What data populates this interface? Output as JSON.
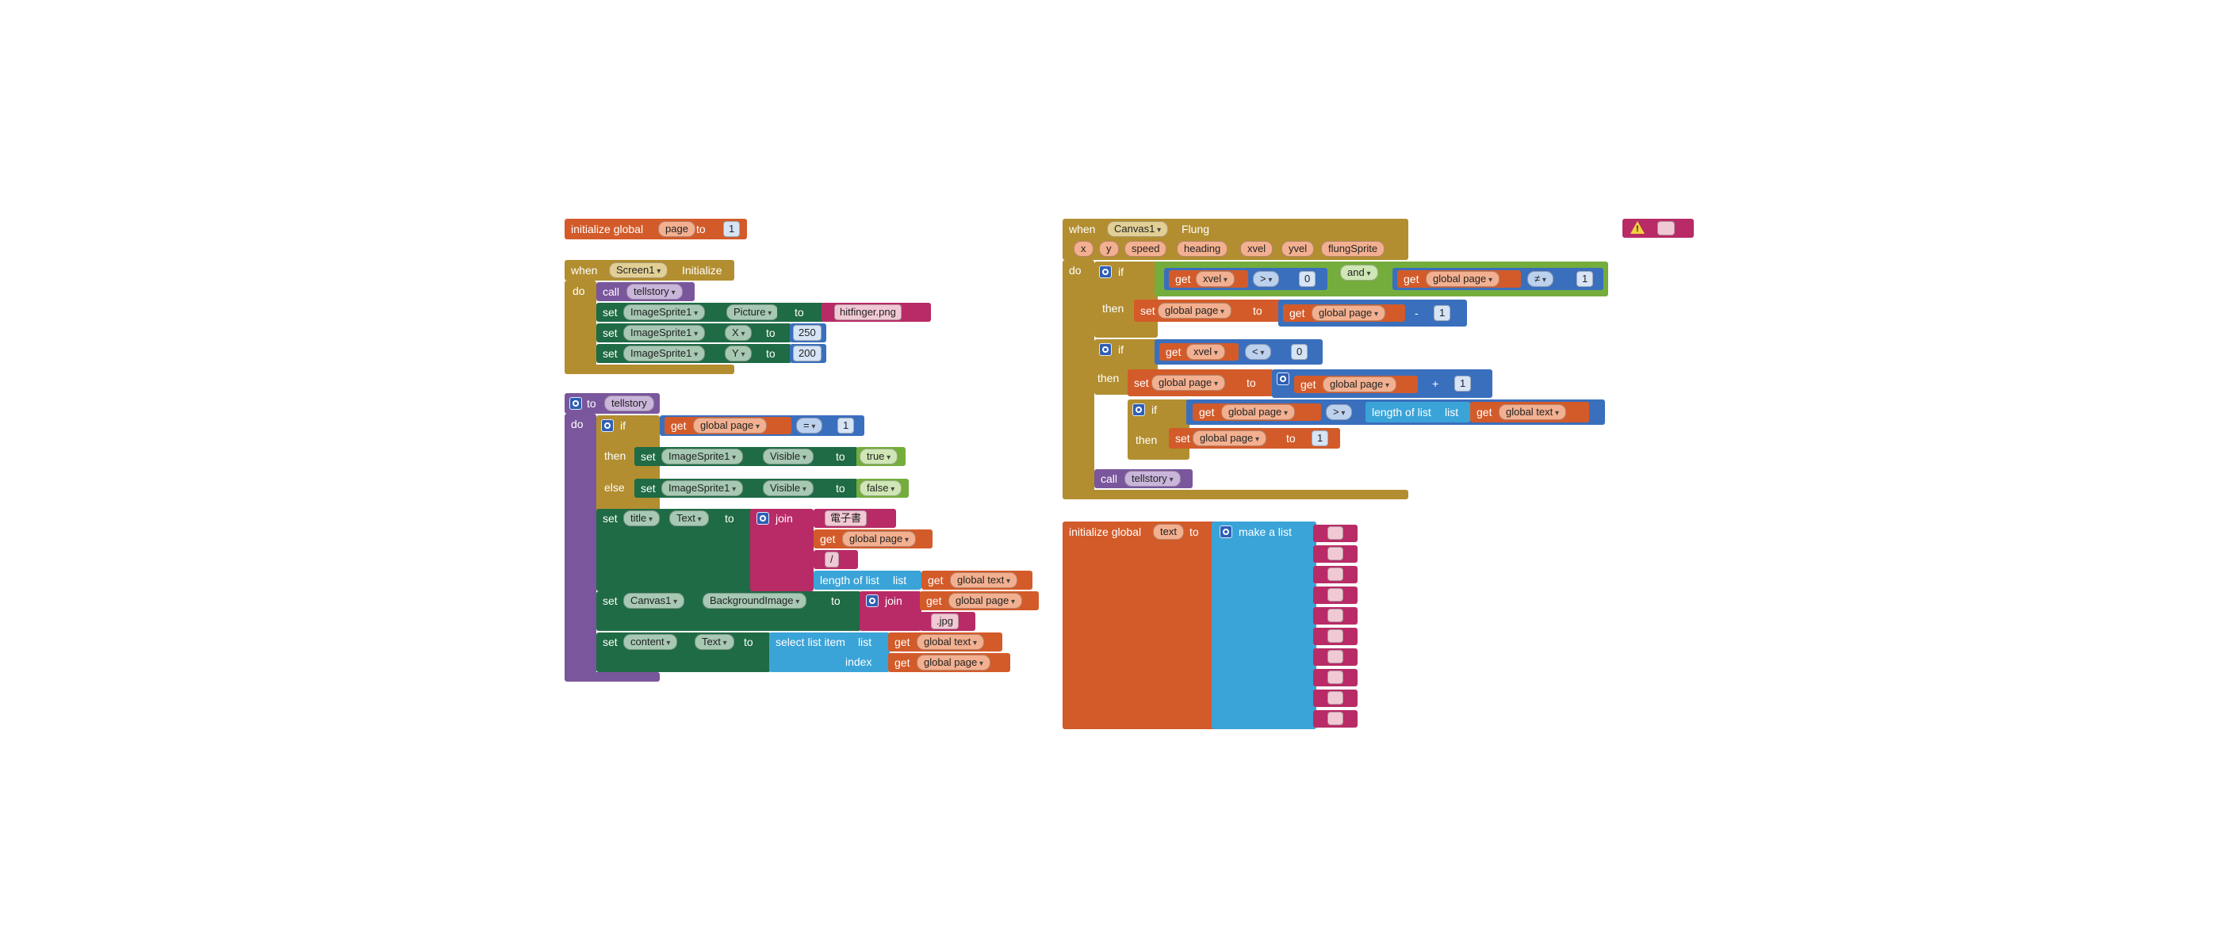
{
  "colors": {
    "variable": "#d35b2a",
    "control": "#b28e30",
    "procedure": "#7a569c",
    "component": "#1f6b45",
    "logic": "#3a6fbd",
    "list": "#3aa4d8",
    "text": "#b82b66",
    "boolean": "#74ad3c"
  },
  "init_page": {
    "label": "initialize global",
    "name": "page",
    "to": "to",
    "value": "1"
  },
  "screen_init": {
    "when": "when",
    "component": "Screen1",
    "event": "Initialize",
    "do": "do",
    "call": "call",
    "proc": "tellstory",
    "set1": {
      "set": "set",
      "comp": "ImageSprite1",
      "prop": "Picture",
      "to": "to",
      "value": "hitfinger.png"
    },
    "set2": {
      "set": "set",
      "comp": "ImageSprite1",
      "prop": "X",
      "to": "to",
      "value": "250"
    },
    "set3": {
      "set": "set",
      "comp": "ImageSprite1",
      "prop": "Y",
      "to": "to",
      "value": "200"
    }
  },
  "tellstory": {
    "to": "to",
    "name": "tellstory",
    "do": "do",
    "if": "if",
    "get": "get",
    "var": "global page",
    "op": "=",
    "cmp": "1",
    "then": "then",
    "else": "else",
    "set_visible_true": {
      "set": "set",
      "comp": "ImageSprite1",
      "prop": "Visible",
      "to": "to",
      "value": "true"
    },
    "set_visible_false": {
      "set": "set",
      "comp": "ImageSprite1",
      "prop": "Visible",
      "to": "to",
      "value": "false"
    },
    "set_title": {
      "set": "set",
      "comp": "title",
      "prop": "Text",
      "to": "to",
      "join": "join",
      "str1": "電子書",
      "get": "get",
      "var": "global page",
      "str2": "/",
      "length": "length of list",
      "list": "list",
      "var2": "global text"
    },
    "set_bg": {
      "set": "set",
      "comp": "Canvas1",
      "prop": "BackgroundImage",
      "to": "to",
      "join": "join",
      "get": "get",
      "var": "global page",
      "str": ".jpg"
    },
    "set_content": {
      "set": "set",
      "comp": "content",
      "prop": "Text",
      "to": "to",
      "select": "select list item",
      "list": "list",
      "index": "index",
      "get": "get",
      "var1": "global text",
      "var2": "global page"
    }
  },
  "flung": {
    "when": "when",
    "component": "Canvas1",
    "event": "Flung",
    "params": [
      "x",
      "y",
      "speed",
      "heading",
      "xvel",
      "yvel",
      "flungSprite"
    ],
    "do": "do",
    "if": "if",
    "then": "then",
    "get": "get",
    "set": "set",
    "to": "to",
    "cond1": {
      "var": "xvel",
      "op": ">",
      "cmp": "0",
      "and": "and",
      "var2": "global page",
      "op2": "≠",
      "cmp2": "1"
    },
    "then1": {
      "var": "global page",
      "var2": "global page",
      "op": "-",
      "val": "1"
    },
    "cond2": {
      "var": "xvel",
      "op": "<",
      "cmp": "0"
    },
    "then2": {
      "var": "global page",
      "var2": "global page",
      "op": "+",
      "val": "1"
    },
    "cond3": {
      "var": "global page",
      "op": ">",
      "length": "length of list",
      "list": "list",
      "var2": "global text"
    },
    "then3": {
      "var": "global page",
      "val": "1"
    },
    "call": "call",
    "proc": "tellstory"
  },
  "init_text": {
    "label": "initialize global",
    "name": "text",
    "to": "to",
    "make": "make a list",
    "item_count": 10
  },
  "warning": {
    "icon": "warning-icon"
  }
}
